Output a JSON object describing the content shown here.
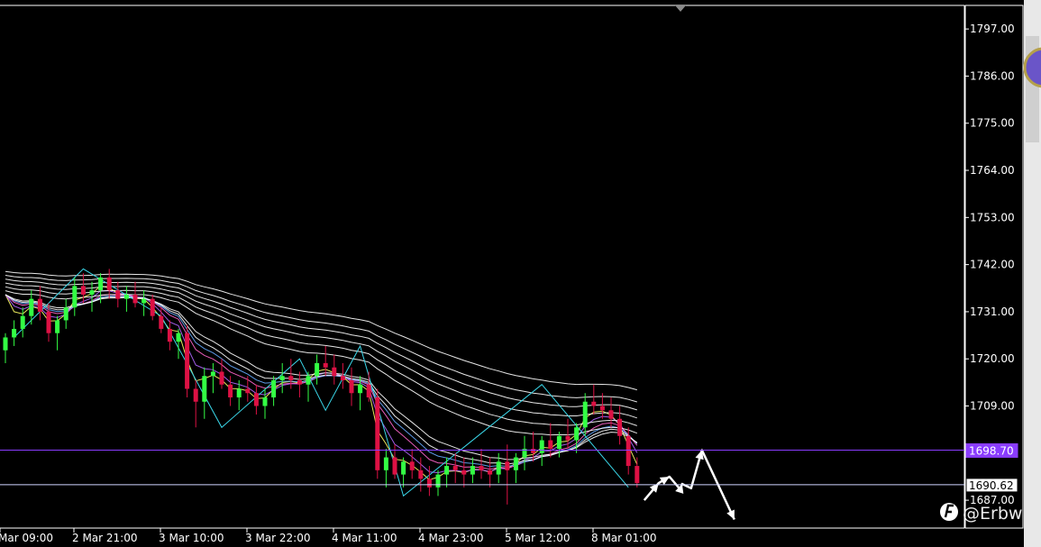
{
  "watermark": "@Erbw",
  "chart_data": {
    "type": "candlestick",
    "title": "",
    "xlabel": "",
    "ylabel": "",
    "ylim": [
      1680.5,
      1802.5
    ],
    "y_ticks": [
      "1797.00",
      "1786.00",
      "1775.00",
      "1764.00",
      "1753.00",
      "1742.00",
      "1731.00",
      "1720.00",
      "1709.00",
      "1687.00"
    ],
    "x_ticks": [
      "Mar 09:00",
      "2 Mar 21:00",
      "3 Mar 10:00",
      "3 Mar 22:00",
      "4 Mar 11:00",
      "4 Mar 23:00",
      "5 Mar 12:00",
      "8 Mar 01:00"
    ],
    "price_lines": [
      {
        "label": "1698.70",
        "value": 1698.7,
        "color": "#8a3cff"
      },
      {
        "label": "1690.62",
        "value": 1690.62,
        "color": "#cfd4ff"
      }
    ],
    "colors": {
      "up": "#33ff44",
      "down": "#dd1144",
      "zigzag": "#3ad6e8",
      "ribbon": "#ffffff",
      "ribbon_inner": [
        "#ffff66",
        "#b466ff",
        "#ff66cc",
        "#66aaff"
      ],
      "forecast": "#ffffff"
    },
    "candles": [
      [
        1722,
        1726,
        1719,
        1725
      ],
      [
        1725,
        1729,
        1723,
        1727
      ],
      [
        1727,
        1732,
        1725,
        1730
      ],
      [
        1730,
        1736,
        1728,
        1734
      ],
      [
        1734,
        1737,
        1729,
        1731
      ],
      [
        1731,
        1733,
        1724,
        1726
      ],
      [
        1726,
        1730,
        1722,
        1729
      ],
      [
        1729,
        1734,
        1727,
        1732
      ],
      [
        1732,
        1739,
        1730,
        1737
      ],
      [
        1737,
        1740,
        1733,
        1735
      ],
      [
        1735,
        1738,
        1731,
        1736
      ],
      [
        1736,
        1740,
        1733,
        1739
      ],
      [
        1739,
        1741,
        1734,
        1736
      ],
      [
        1736,
        1738,
        1732,
        1734
      ],
      [
        1734,
        1737,
        1731,
        1735
      ],
      [
        1735,
        1738,
        1732,
        1733
      ],
      [
        1733,
        1736,
        1730,
        1734
      ],
      [
        1734,
        1735,
        1729,
        1730
      ],
      [
        1730,
        1732,
        1726,
        1727
      ],
      [
        1727,
        1729,
        1722,
        1724
      ],
      [
        1724,
        1727,
        1720,
        1726
      ],
      [
        1726,
        1728,
        1711,
        1713
      ],
      [
        1713,
        1715,
        1704,
        1710
      ],
      [
        1710,
        1718,
        1706,
        1716
      ],
      [
        1716,
        1719,
        1712,
        1717
      ],
      [
        1717,
        1720,
        1713,
        1714
      ],
      [
        1714,
        1716,
        1709,
        1711
      ],
      [
        1711,
        1715,
        1708,
        1713
      ],
      [
        1713,
        1716,
        1710,
        1712
      ],
      [
        1712,
        1714,
        1707,
        1709
      ],
      [
        1709,
        1713,
        1706,
        1711
      ],
      [
        1711,
        1716,
        1709,
        1715
      ],
      [
        1715,
        1719,
        1712,
        1716
      ],
      [
        1716,
        1720,
        1713,
        1715
      ],
      [
        1715,
        1717,
        1711,
        1714
      ],
      [
        1714,
        1717,
        1710,
        1716
      ],
      [
        1716,
        1721,
        1714,
        1719
      ],
      [
        1719,
        1723,
        1716,
        1718
      ],
      [
        1718,
        1721,
        1714,
        1716
      ],
      [
        1716,
        1719,
        1713,
        1715
      ],
      [
        1715,
        1718,
        1709,
        1712
      ],
      [
        1712,
        1716,
        1708,
        1714
      ],
      [
        1714,
        1717,
        1710,
        1711
      ],
      [
        1711,
        1713,
        1692,
        1694
      ],
      [
        1694,
        1699,
        1690,
        1697
      ],
      [
        1697,
        1700,
        1692,
        1693
      ],
      [
        1693,
        1697,
        1690,
        1696
      ],
      [
        1696,
        1699,
        1692,
        1694
      ],
      [
        1694,
        1697,
        1689,
        1692
      ],
      [
        1692,
        1695,
        1688,
        1690
      ],
      [
        1690,
        1694,
        1688,
        1693
      ],
      [
        1693,
        1697,
        1690,
        1695
      ],
      [
        1695,
        1698,
        1691,
        1694
      ],
      [
        1694,
        1697,
        1690,
        1693
      ],
      [
        1693,
        1697,
        1691,
        1695
      ],
      [
        1695,
        1699,
        1692,
        1694
      ],
      [
        1694,
        1697,
        1690,
        1693
      ],
      [
        1693,
        1698,
        1691,
        1696
      ],
      [
        1696,
        1700,
        1686,
        1694
      ],
      [
        1694,
        1698,
        1691,
        1697
      ],
      [
        1697,
        1702,
        1694,
        1699
      ],
      [
        1699,
        1703,
        1696,
        1698
      ],
      [
        1698,
        1702,
        1695,
        1701
      ],
      [
        1701,
        1705,
        1697,
        1699
      ],
      [
        1699,
        1703,
        1697,
        1702
      ],
      [
        1702,
        1706,
        1699,
        1701
      ],
      [
        1701,
        1705,
        1698,
        1704
      ],
      [
        1704,
        1712,
        1702,
        1710
      ],
      [
        1710,
        1714,
        1707,
        1709
      ],
      [
        1709,
        1712,
        1706,
        1708
      ],
      [
        1708,
        1711,
        1704,
        1706
      ],
      [
        1706,
        1709,
        1700,
        1702
      ],
      [
        1702,
        1704,
        1693,
        1695
      ],
      [
        1695,
        1697,
        1690,
        1691
      ]
    ],
    "zigzag": [
      [
        1,
        1725
      ],
      [
        9,
        1741
      ],
      [
        18,
        1730
      ],
      [
        25,
        1704
      ],
      [
        34,
        1720
      ],
      [
        37,
        1708
      ],
      [
        41,
        1723
      ],
      [
        46,
        1688
      ],
      [
        62,
        1714
      ],
      [
        72,
        1690
      ]
    ],
    "forecast": [
      [
        1697.5,
        1687
      ],
      [
        1699.8,
        1691
      ],
      [
        1701.5,
        1692.5
      ],
      [
        1702.9,
        1689.5
      ],
      [
        1704.1,
        1690.8
      ],
      [
        1705.3,
        1689.8
      ],
      [
        1706.9,
        1698.7
      ],
      [
        1710.7,
        1682.5
      ]
    ]
  }
}
